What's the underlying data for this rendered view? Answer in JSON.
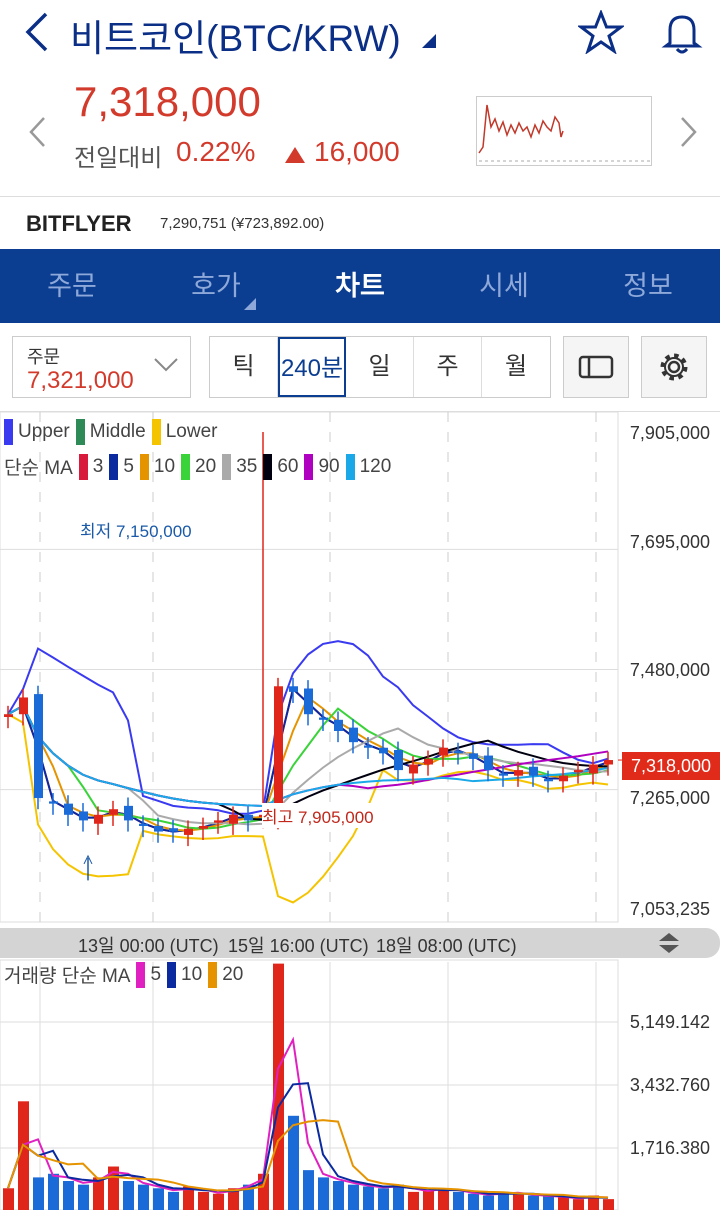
{
  "header": {
    "title": "비트코인(BTC/KRW)",
    "price": "7,318,000",
    "compare_label": "전일대비",
    "percent": "0.22%",
    "change": "16,000"
  },
  "exchange": {
    "name": "BITFLYER",
    "value": "7,290,751 (¥723,892.00)"
  },
  "tabs": [
    {
      "label": "주문"
    },
    {
      "label": "호가"
    },
    {
      "label": "차트"
    },
    {
      "label": "시세"
    },
    {
      "label": "정보"
    }
  ],
  "order": {
    "label": "주문",
    "value": "7,321,000"
  },
  "periods": [
    {
      "label": "틱"
    },
    {
      "label": "240분"
    },
    {
      "label": "일"
    },
    {
      "label": "주"
    },
    {
      "label": "월"
    }
  ],
  "legend": {
    "bb": [
      {
        "label": "Upper",
        "color": "#3a3af0"
      },
      {
        "label": "Middle",
        "color": "#2e8b57"
      },
      {
        "label": "Lower",
        "color": "#f5c400"
      }
    ],
    "ma_label": "단순 MA",
    "ma": [
      {
        "label": "3",
        "color": "#d81b3c"
      },
      {
        "label": "5",
        "color": "#0b2aa0"
      },
      {
        "label": "10",
        "color": "#e59400"
      },
      {
        "label": "20",
        "color": "#3ad33a"
      },
      {
        "label": "35",
        "color": "#aaaaaa"
      },
      {
        "label": "60",
        "color": "#000010"
      },
      {
        "label": "90",
        "color": "#b000c0"
      },
      {
        "label": "120",
        "color": "#1aa8e8"
      }
    ],
    "vol_label": "거래량 단순 MA",
    "vol_ma": [
      {
        "label": "5",
        "color": "#e020c0"
      },
      {
        "label": "10",
        "color": "#0b2aa0"
      },
      {
        "label": "20",
        "color": "#e59400"
      }
    ]
  },
  "chart_data": {
    "type": "candlestick",
    "y_ticks": [
      "7,905,000",
      "7,695,000",
      "7,480,000",
      "7,265,000",
      "7,053,235"
    ],
    "ylim": [
      7053235,
      7905000
    ],
    "current_price_label": "7,318,000",
    "low_annotation": "최저 7,150,000",
    "high_annotation": "최고 7,905,000",
    "x_labels": [
      "13일 00:00 (UTC)",
      "15일 16:00 (UTC)",
      "18일 08:00 (UTC)"
    ],
    "closes": [
      7400000,
      7430000,
      7250000,
      7240000,
      7220000,
      7210000,
      7220000,
      7230000,
      7210000,
      7200000,
      7190000,
      7190000,
      7195000,
      7200000,
      7210000,
      7220000,
      7210000,
      7220000,
      7450000,
      7440000,
      7400000,
      7390000,
      7370000,
      7350000,
      7340000,
      7330000,
      7300000,
      7310000,
      7320000,
      7340000,
      7330000,
      7320000,
      7300000,
      7290000,
      7300000,
      7290000,
      7280000,
      7290000,
      7300000,
      7310000,
      7318000
    ],
    "spike_index": 17,
    "spike_high": 7905000,
    "volume_ticks": [
      "5,149.142",
      "3,432.760",
      "1,716.380"
    ],
    "volume_max": 6900,
    "volumes": [
      600,
      3000,
      900,
      1000,
      800,
      700,
      900,
      1200,
      800,
      700,
      600,
      500,
      650,
      500,
      450,
      600,
      700,
      1000,
      6800,
      2600,
      1100,
      900,
      800,
      700,
      650,
      600,
      700,
      500,
      550,
      600,
      500,
      450,
      400,
      500,
      450,
      400,
      380,
      350,
      300,
      400,
      300
    ]
  }
}
